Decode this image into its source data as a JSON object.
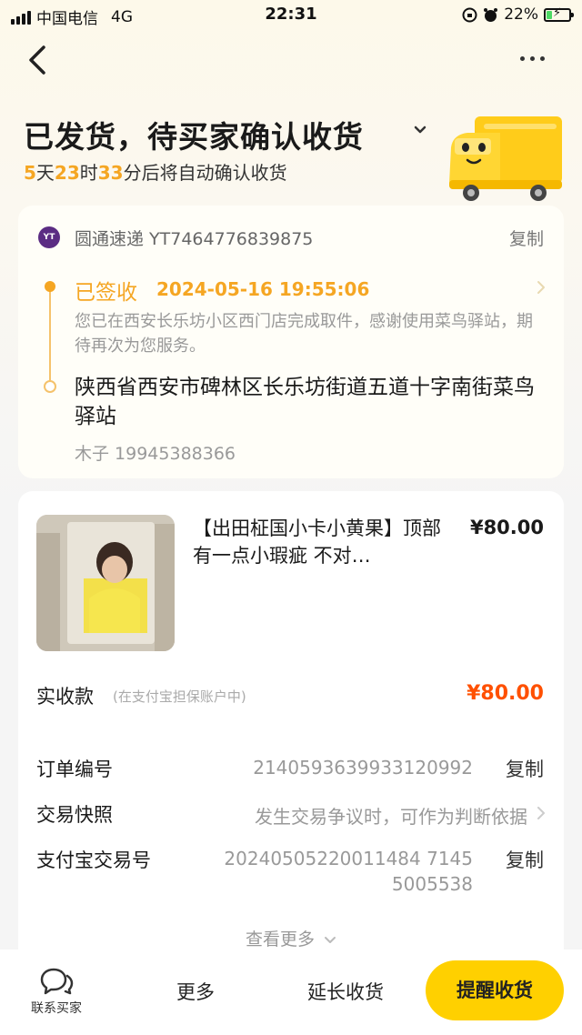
{
  "status_bar": {
    "carrier": "中国电信",
    "network": "4G",
    "time": "22:31",
    "battery": "22%"
  },
  "header": {
    "title": "已发货，待买家确认收货",
    "countdown": {
      "days": "5",
      "days_unit": "天",
      "hours": "23",
      "hours_unit": "时",
      "minutes": "33",
      "suffix": "分后将自动确认收货"
    }
  },
  "logistics": {
    "courier": "圆通速递 YT7464776839875",
    "copy_label": "复制",
    "status": "已签收",
    "status_time": "2024-05-16 19:55:06",
    "pickup_desc": "您已在西安长乐坊小区西门店完成取件，感谢使用菜鸟驿站，期待再次为您服务。",
    "address": "陕西省西安市碑林区长乐坊街道五道十字南街菜鸟驿站",
    "recipient": "木子 19945388366"
  },
  "order": {
    "product_title": "【出田柾国小卡小黄果】顶部有一点小瑕疵 不对…",
    "product_price": "¥80.00",
    "paid_label": "实收款",
    "paid_note": "(在支付宝担保账户中)",
    "paid_amount": "¥80.00",
    "order_no_label": "订单编号",
    "order_no": "2140593639933120992",
    "order_no_copy": "复制",
    "snapshot_label": "交易快照",
    "snapshot_value": "发生交易争议时，可作为判断依据",
    "alipay_label": "支付宝交易号",
    "alipay_no_line1": "20240505220011484 7145",
    "alipay_no_line2": "5005538",
    "alipay_copy": "复制",
    "view_more": "查看更多"
  },
  "bottom_bar": {
    "contact_label": "联系买家",
    "more_label": "更多",
    "extend_label": "延长收货",
    "remind_label": "提醒收货"
  },
  "colors": {
    "accent_yellow": "#ffd000",
    "status_orange": "#f5a623",
    "price_red": "#ff5000"
  }
}
